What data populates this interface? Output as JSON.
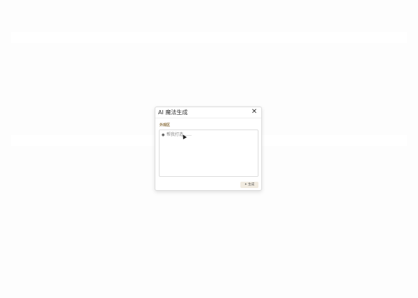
{
  "dialog": {
    "title": "AI 魔法生成",
    "close_glyph": "✕",
    "section_label": "外观区",
    "prompt": {
      "bullet": "●",
      "placeholder": "帮我打造……"
    },
    "generate_button": {
      "icon": "✦",
      "label": "生成"
    }
  },
  "colors": {
    "accent_label": "#8a6d3b",
    "button_bg": "#f1ebe0"
  }
}
